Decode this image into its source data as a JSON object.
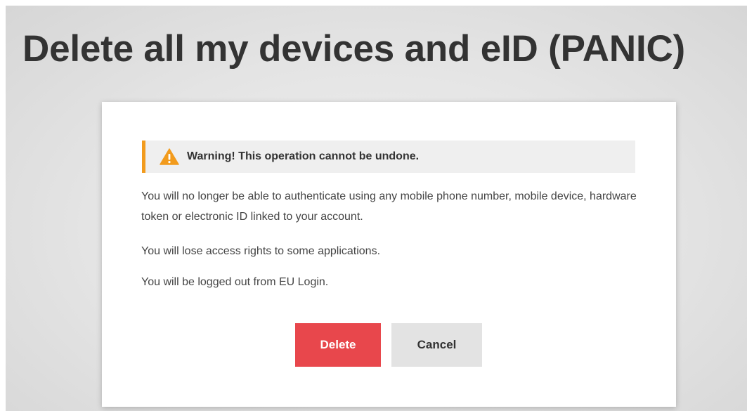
{
  "page": {
    "title": "Delete all my devices and eID (PANIC)"
  },
  "dialog": {
    "warning": {
      "icon": "warning-triangle-icon",
      "text": "Warning! This operation cannot be undone.",
      "accent_color": "#f29b1d"
    },
    "paragraphs": [
      "You will no longer be able to authenticate using any mobile phone number, mobile device, hardware token or electronic ID linked to your account.",
      "You will lose access rights to some applications.",
      "You will be logged out from EU Login."
    ],
    "buttons": {
      "delete_label": "Delete",
      "delete_color": "#e8474c",
      "cancel_label": "Cancel"
    }
  }
}
